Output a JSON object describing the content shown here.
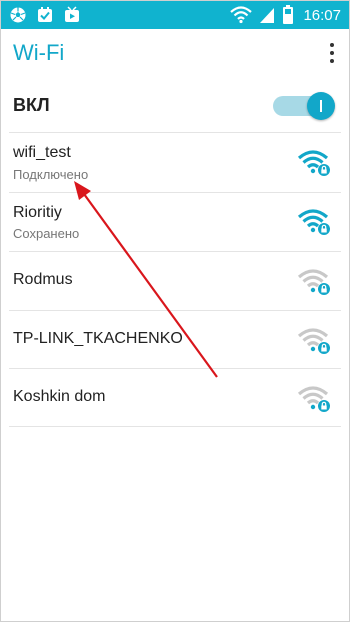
{
  "status_bar": {
    "time": "16:07",
    "left_icons": [
      "soccer-ball-icon",
      "checkbox-icon",
      "video-icon"
    ],
    "right_icons": [
      "wifi-signal-icon",
      "cell-signal-icon",
      "battery-icon"
    ]
  },
  "header": {
    "title": "Wi-Fi",
    "menu_icon": "overflow-menu-icon"
  },
  "wifi_toggle": {
    "label": "ВКЛ",
    "state": "on"
  },
  "networks": [
    {
      "name": "wifi_test",
      "status": "Подключено",
      "signal": "full",
      "secured": true
    },
    {
      "name": "Rioritiy",
      "status": "Сохранено",
      "signal": "full",
      "secured": true
    },
    {
      "name": "Rodmus",
      "status": "",
      "signal": "weak",
      "secured": true
    },
    {
      "name": "TP-LINK_TKACHENKO",
      "status": "",
      "signal": "weak",
      "secured": true
    },
    {
      "name": "Koshkin dom",
      "status": "",
      "signal": "weak",
      "secured": true
    }
  ],
  "colors": {
    "accent": "#12a7c9",
    "status_bar": "#10b3cf",
    "wifi_strong": "#12a7c9",
    "wifi_weak": "#c8c8c8",
    "annotation_arrow": "#d9161c"
  }
}
